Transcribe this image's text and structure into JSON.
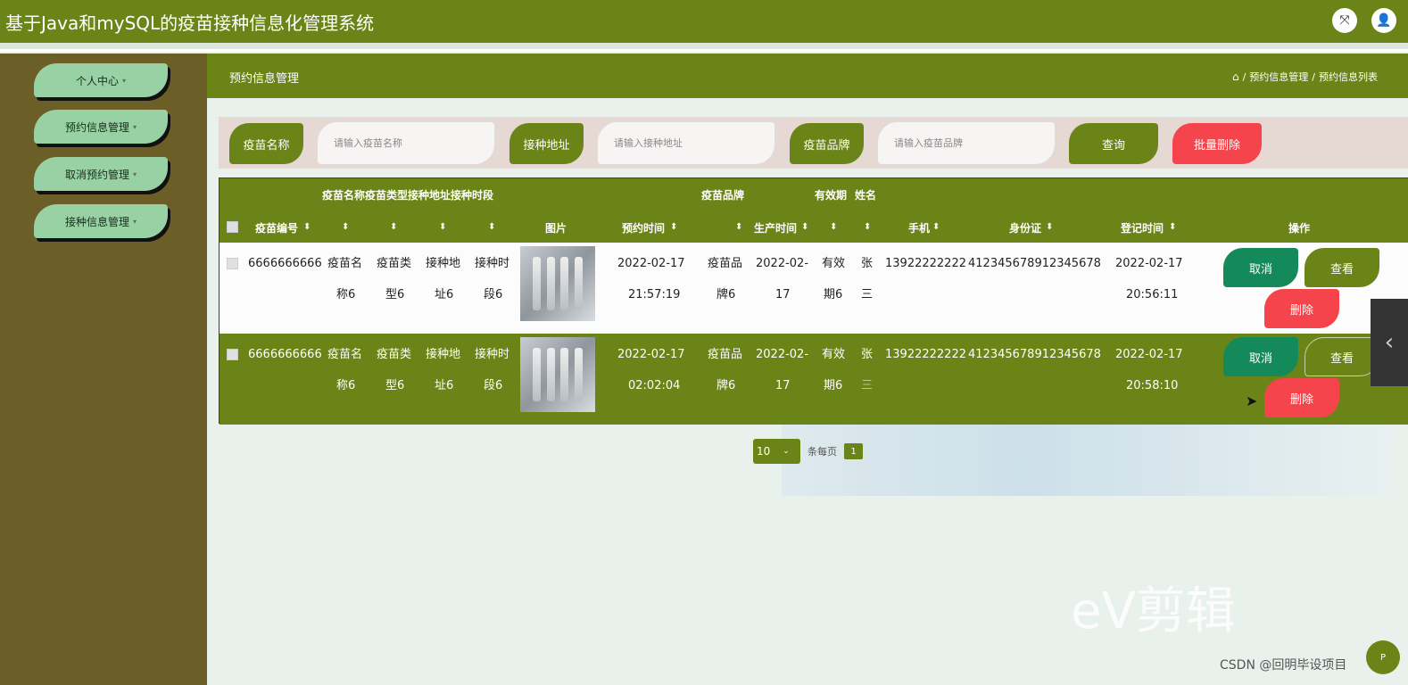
{
  "app": {
    "title": "基于Java和mySQL的疫苗接种信息化管理系统"
  },
  "sidebar": {
    "items": [
      {
        "label": "个人中心"
      },
      {
        "label": "预约信息管理"
      },
      {
        "label": "取消预约管理"
      },
      {
        "label": "接种信息管理"
      }
    ]
  },
  "header": {
    "title": "预约信息管理",
    "breadcrumb": [
      "预约信息管理",
      "预约信息列表"
    ]
  },
  "search": {
    "name_label": "疫苗名称",
    "name_placeholder": "请输入疫苗名称",
    "address_label": "接种地址",
    "address_placeholder": "请输入接种地址",
    "brand_label": "疫苗品牌",
    "brand_placeholder": "请输入疫苗品牌",
    "query": "查询",
    "batch_delete": "批量删除"
  },
  "table": {
    "top_headers": {
      "group1": "疫苗名称疫苗类型接种地址接种时段",
      "brand": "疫苗品牌",
      "validity": "有效期",
      "name": "姓名"
    },
    "headers": {
      "code": "疫苗编号",
      "image": "图片",
      "reserve_time": "预约时间",
      "produce_time": "生产时间",
      "phone": "手机",
      "idcard": "身份证",
      "register_time": "登记时间",
      "actions": "操作"
    },
    "rows": [
      {
        "code": "6666666666",
        "name_a": "疫苗名",
        "name_b": "称6",
        "type_a": "疫苗类",
        "type_b": "型6",
        "addr_a": "接种地",
        "addr_b": "址6",
        "slot_a": "接种时",
        "slot_b": "段6",
        "rt_date": "2022-02-17",
        "rt_time": "21:57:19",
        "brand_a": "疫苗品",
        "brand_b": "牌6",
        "pt_a": "2022-02-",
        "pt_b": "17",
        "val_a": "有效",
        "val_b": "期6",
        "pn_a": "张",
        "pn_b": "三",
        "phone": "13922222222",
        "idcard": "412345678912345678",
        "reg_date": "2022-02-17",
        "reg_time": "20:56:11"
      },
      {
        "code": "6666666666",
        "name_a": "疫苗名",
        "name_b": "称6",
        "type_a": "疫苗类",
        "type_b": "型6",
        "addr_a": "接种地",
        "addr_b": "址6",
        "slot_a": "接种时",
        "slot_b": "段6",
        "rt_date": "2022-02-17",
        "rt_time": "02:02:04",
        "brand_a": "疫苗品",
        "brand_b": "牌6",
        "pt_a": "2022-02-",
        "pt_b": "17",
        "val_a": "有效",
        "val_b": "期6",
        "pn_a": "张",
        "pn_b": "三",
        "phone": "13922222222",
        "idcard": "412345678912345678",
        "reg_date": "2022-02-17",
        "reg_time": "20:58:10"
      }
    ],
    "actions": {
      "cancel": "取消",
      "view": "查看",
      "delete": "删除"
    }
  },
  "pager": {
    "page_size": "10",
    "per_page": "条每页",
    "current": "1"
  },
  "watermark": {
    "text": "eV剪辑",
    "csdn": "CSDN @回明毕设项目"
  },
  "fab": {
    "label": "P"
  }
}
